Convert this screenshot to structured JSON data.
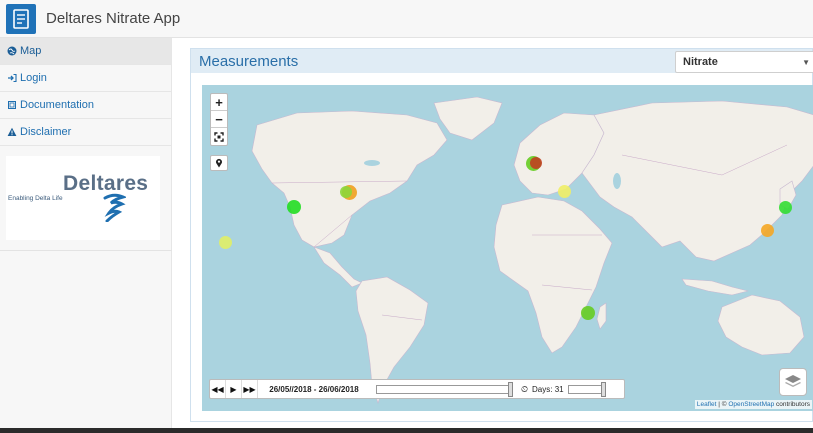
{
  "app": {
    "title": "Deltares Nitrate App"
  },
  "sidebar": {
    "items": [
      {
        "label": "Map",
        "icon": "globe-icon",
        "active": true
      },
      {
        "label": "Login",
        "icon": "login-icon"
      },
      {
        "label": "Documentation",
        "icon": "book-icon"
      },
      {
        "label": "Disclaimer",
        "icon": "warning-icon"
      }
    ],
    "brand": {
      "name": "Deltares",
      "tagline": "Enabling Delta Life"
    }
  },
  "panel": {
    "title": "Measurements",
    "select_value": "Nitrate"
  },
  "map": {
    "zoom_in": "+",
    "zoom_out": "−",
    "player": {
      "date_range": "26/05//2018 - 26/06/2018",
      "days_label": "Days: 31"
    },
    "attribution": {
      "leaflet": "Leaflet",
      "separator": " | © ",
      "osm": "OpenStreetMap",
      "suffix": " contributors"
    }
  },
  "measurements": [
    {
      "location": "US west coast",
      "color": "#22dd22"
    },
    {
      "location": "Pacific",
      "color": "#e0ee66"
    },
    {
      "location": "US midwest",
      "color": "#f0a020"
    },
    {
      "location": "US midwest 2",
      "color": "#8cd63a"
    },
    {
      "location": "Europe NW",
      "color": "#66cc22"
    },
    {
      "location": "Europe NW 2",
      "color": "#c04020"
    },
    {
      "location": "Balkans",
      "color": "#f0ee66"
    },
    {
      "location": "Japan",
      "color": "#33dd33"
    },
    {
      "location": "Taiwan",
      "color": "#f5a623"
    },
    {
      "location": "Mozambique",
      "color": "#66cc22"
    }
  ]
}
